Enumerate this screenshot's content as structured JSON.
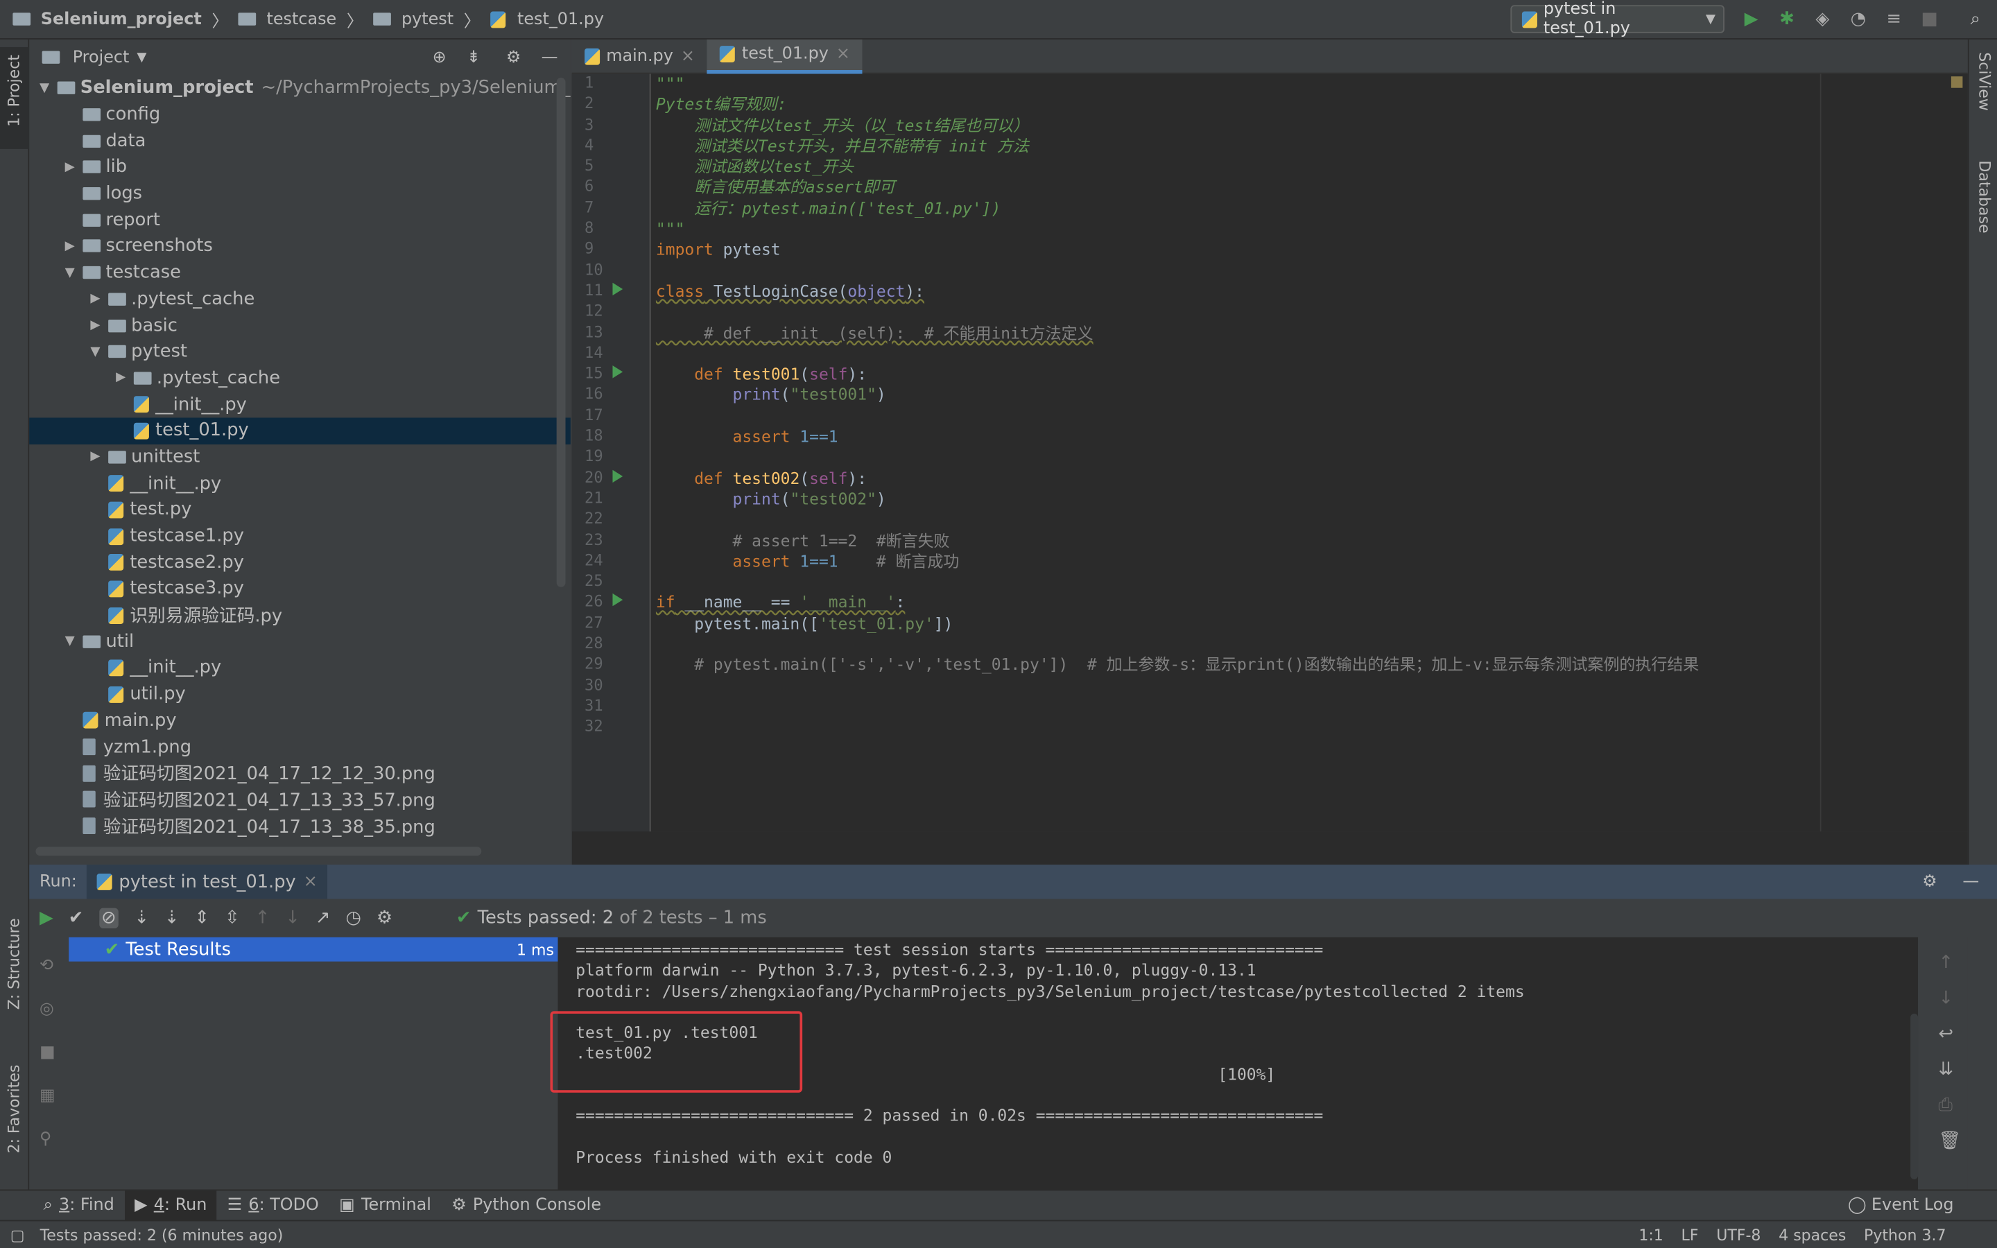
{
  "breadcrumb": [
    "Selenium_project",
    "testcase",
    "pytest",
    "test_01.py"
  ],
  "run_config": "pytest in test_01.py",
  "left_strip": {
    "project": "1: Project",
    "structure": "Z: Structure",
    "favorites": "2: Favorites"
  },
  "right_strip": {
    "sciview": "SciView",
    "database": "Database"
  },
  "project_panel": {
    "title": "Project",
    "tree": [
      {
        "label": "Selenium_project",
        "extra": "~/PycharmProjects_py3/Selenium_",
        "depth": 0,
        "type": "folder",
        "arrow": "down",
        "bold": true
      },
      {
        "label": "config",
        "depth": 1,
        "type": "folder",
        "arrow": ""
      },
      {
        "label": "data",
        "depth": 1,
        "type": "folder",
        "arrow": ""
      },
      {
        "label": "lib",
        "depth": 1,
        "type": "folder",
        "arrow": "right"
      },
      {
        "label": "logs",
        "depth": 1,
        "type": "folder",
        "arrow": ""
      },
      {
        "label": "report",
        "depth": 1,
        "type": "folder",
        "arrow": ""
      },
      {
        "label": "screenshots",
        "depth": 1,
        "type": "folder",
        "arrow": "right"
      },
      {
        "label": "testcase",
        "depth": 1,
        "type": "folder",
        "arrow": "down"
      },
      {
        "label": ".pytest_cache",
        "depth": 2,
        "type": "folder",
        "arrow": "right"
      },
      {
        "label": "basic",
        "depth": 2,
        "type": "folder",
        "arrow": "right"
      },
      {
        "label": "pytest",
        "depth": 2,
        "type": "folder",
        "arrow": "down"
      },
      {
        "label": ".pytest_cache",
        "depth": 3,
        "type": "folder",
        "arrow": "right"
      },
      {
        "label": "__init__.py",
        "depth": 3,
        "type": "py",
        "arrow": ""
      },
      {
        "label": "test_01.py",
        "depth": 3,
        "type": "py",
        "arrow": "",
        "selected": true
      },
      {
        "label": "unittest",
        "depth": 2,
        "type": "folder",
        "arrow": "right"
      },
      {
        "label": "__init__.py",
        "depth": 2,
        "type": "py",
        "arrow": ""
      },
      {
        "label": "test.py",
        "depth": 2,
        "type": "py",
        "arrow": ""
      },
      {
        "label": "testcase1.py",
        "depth": 2,
        "type": "py",
        "arrow": ""
      },
      {
        "label": "testcase2.py",
        "depth": 2,
        "type": "py",
        "arrow": ""
      },
      {
        "label": "testcase3.py",
        "depth": 2,
        "type": "py",
        "arrow": ""
      },
      {
        "label": "识别易源验证码.py",
        "depth": 2,
        "type": "py",
        "arrow": ""
      },
      {
        "label": "util",
        "depth": 1,
        "type": "folder",
        "arrow": "down"
      },
      {
        "label": "__init__.py",
        "depth": 2,
        "type": "py",
        "arrow": ""
      },
      {
        "label": "util.py",
        "depth": 2,
        "type": "py",
        "arrow": ""
      },
      {
        "label": "main.py",
        "depth": 1,
        "type": "py",
        "arrow": ""
      },
      {
        "label": "yzm1.png",
        "depth": 1,
        "type": "png",
        "arrow": ""
      },
      {
        "label": "验证码切图2021_04_17_12_12_30.png",
        "depth": 1,
        "type": "png",
        "arrow": ""
      },
      {
        "label": "验证码切图2021_04_17_13_33_57.png",
        "depth": 1,
        "type": "png",
        "arrow": ""
      },
      {
        "label": "验证码切图2021_04_17_13_38_35.png",
        "depth": 1,
        "type": "png",
        "arrow": ""
      }
    ]
  },
  "editor_tabs": [
    {
      "label": "main.py",
      "active": false
    },
    {
      "label": "test_01.py",
      "active": true
    }
  ],
  "run_gutter_lines": [
    11,
    15,
    20,
    26
  ],
  "code": [
    [
      [
        "\"\"\"",
        "doc"
      ]
    ],
    [
      [
        "Pytest编写规则:",
        "doc"
      ]
    ],
    [
      [
        "    测试文件以test_开头（以_test结尾也可以）",
        "doc"
      ]
    ],
    [
      [
        "    测试类以Test开头，并且不能带有 init 方法",
        "doc"
      ]
    ],
    [
      [
        "    测试函数以test_开头",
        "doc"
      ]
    ],
    [
      [
        "    断言使用基本的assert即可",
        "doc"
      ]
    ],
    [
      [
        "    运行：pytest.main(['test_01.py'])",
        "doc"
      ]
    ],
    [
      [
        "\"\"\"",
        "doc"
      ]
    ],
    [
      [
        "import",
        "kw"
      ],
      [
        " pytest",
        ""
      ]
    ],
    [],
    [
      [
        "class",
        "kw wv"
      ],
      [
        " TestLoginCase(",
        "wv"
      ],
      [
        "object",
        "bi wv"
      ],
      [
        "):",
        "wv"
      ]
    ],
    [],
    [
      [
        "     # def __init__(self):  # 不能用init方法定义",
        "cm wv"
      ]
    ],
    [],
    [
      [
        "    ",
        ""
      ],
      [
        "def",
        "kw"
      ],
      [
        " ",
        ""
      ],
      [
        "test001",
        "fn"
      ],
      [
        "(",
        ""
      ],
      [
        "self",
        "slf"
      ],
      [
        "):",
        ""
      ]
    ],
    [
      [
        "        ",
        ""
      ],
      [
        "print",
        "bi"
      ],
      [
        "(",
        ""
      ],
      [
        "\"test001\"",
        "str"
      ],
      [
        ")",
        ""
      ]
    ],
    [],
    [
      [
        "        ",
        ""
      ],
      [
        "assert",
        "kw"
      ],
      [
        " ",
        ""
      ],
      [
        "1==1",
        "num"
      ]
    ],
    [],
    [
      [
        "    ",
        ""
      ],
      [
        "def",
        "kw"
      ],
      [
        " ",
        ""
      ],
      [
        "test002",
        "fn"
      ],
      [
        "(",
        ""
      ],
      [
        "self",
        "slf"
      ],
      [
        "):",
        ""
      ]
    ],
    [
      [
        "        ",
        ""
      ],
      [
        "print",
        "bi"
      ],
      [
        "(",
        ""
      ],
      [
        "\"test002\"",
        "str"
      ],
      [
        ")",
        ""
      ]
    ],
    [],
    [
      [
        "        # assert 1==2  #断言失败",
        "cm"
      ]
    ],
    [
      [
        "        ",
        ""
      ],
      [
        "assert",
        "kw"
      ],
      [
        " ",
        ""
      ],
      [
        "1==1",
        "num"
      ],
      [
        "    # 断言成功",
        "cm"
      ]
    ],
    [],
    [
      [
        "if",
        "kw wv"
      ],
      [
        " __name__ == ",
        "wv"
      ],
      [
        "'__main__'",
        "str wv"
      ],
      [
        ":",
        "wv"
      ]
    ],
    [
      [
        "    pytest.main([",
        ""
      ],
      [
        "'test_01.py'",
        "str"
      ],
      [
        "])",
        ""
      ]
    ],
    [],
    [
      [
        "    # pytest.main(['-s','-v','test_01.py'])  # 加上参数-s：显示print()函数输出的结果；加上-v:显示每条测试案例的执行结果",
        "cm"
      ]
    ],
    [],
    [],
    []
  ],
  "run_panel": {
    "label": "Run:",
    "tab": "pytest in test_01.py",
    "status_prefix": "Tests passed:",
    "status_count": "2",
    "status_of": "of 2 tests",
    "status_time": "– 1 ms",
    "test_results_label": "Test Results",
    "test_results_time": "1 ms",
    "console": [
      "============================ test session starts =============================",
      "platform darwin -- Python 3.7.3, pytest-6.2.3, py-1.10.0, pluggy-0.13.1",
      "rootdir: /Users/zhengxiaofang/PycharmProjects_py3/Selenium_project/testcase/pytestcollected 2 items",
      "",
      "test_01.py .test001",
      ".test002",
      "                                                                   [100%]",
      "",
      "============================= 2 passed in 0.02s ==============================",
      "",
      "Process finished with exit code 0"
    ],
    "highlight_color": "#e0393e"
  },
  "bottom_tabs": [
    {
      "num": "3",
      "label": ": Find"
    },
    {
      "num": "4",
      "label": ": Run",
      "active": true
    },
    {
      "num": "6",
      "label": ": TODO"
    },
    {
      "num": "",
      "label": "Terminal"
    },
    {
      "num": "",
      "label": "Python Console"
    }
  ],
  "event_log": "Event Log",
  "status_bar": {
    "message": "Tests passed: 2 (6 minutes ago)",
    "position": "1:1",
    "line_sep": "LF",
    "encoding": "UTF-8",
    "indent": "4 spaces",
    "interpreter": "Python 3.7"
  },
  "colors": {
    "accent": "#4a88c7",
    "selection": "#2f65ca",
    "run_green": "#499c54"
  }
}
